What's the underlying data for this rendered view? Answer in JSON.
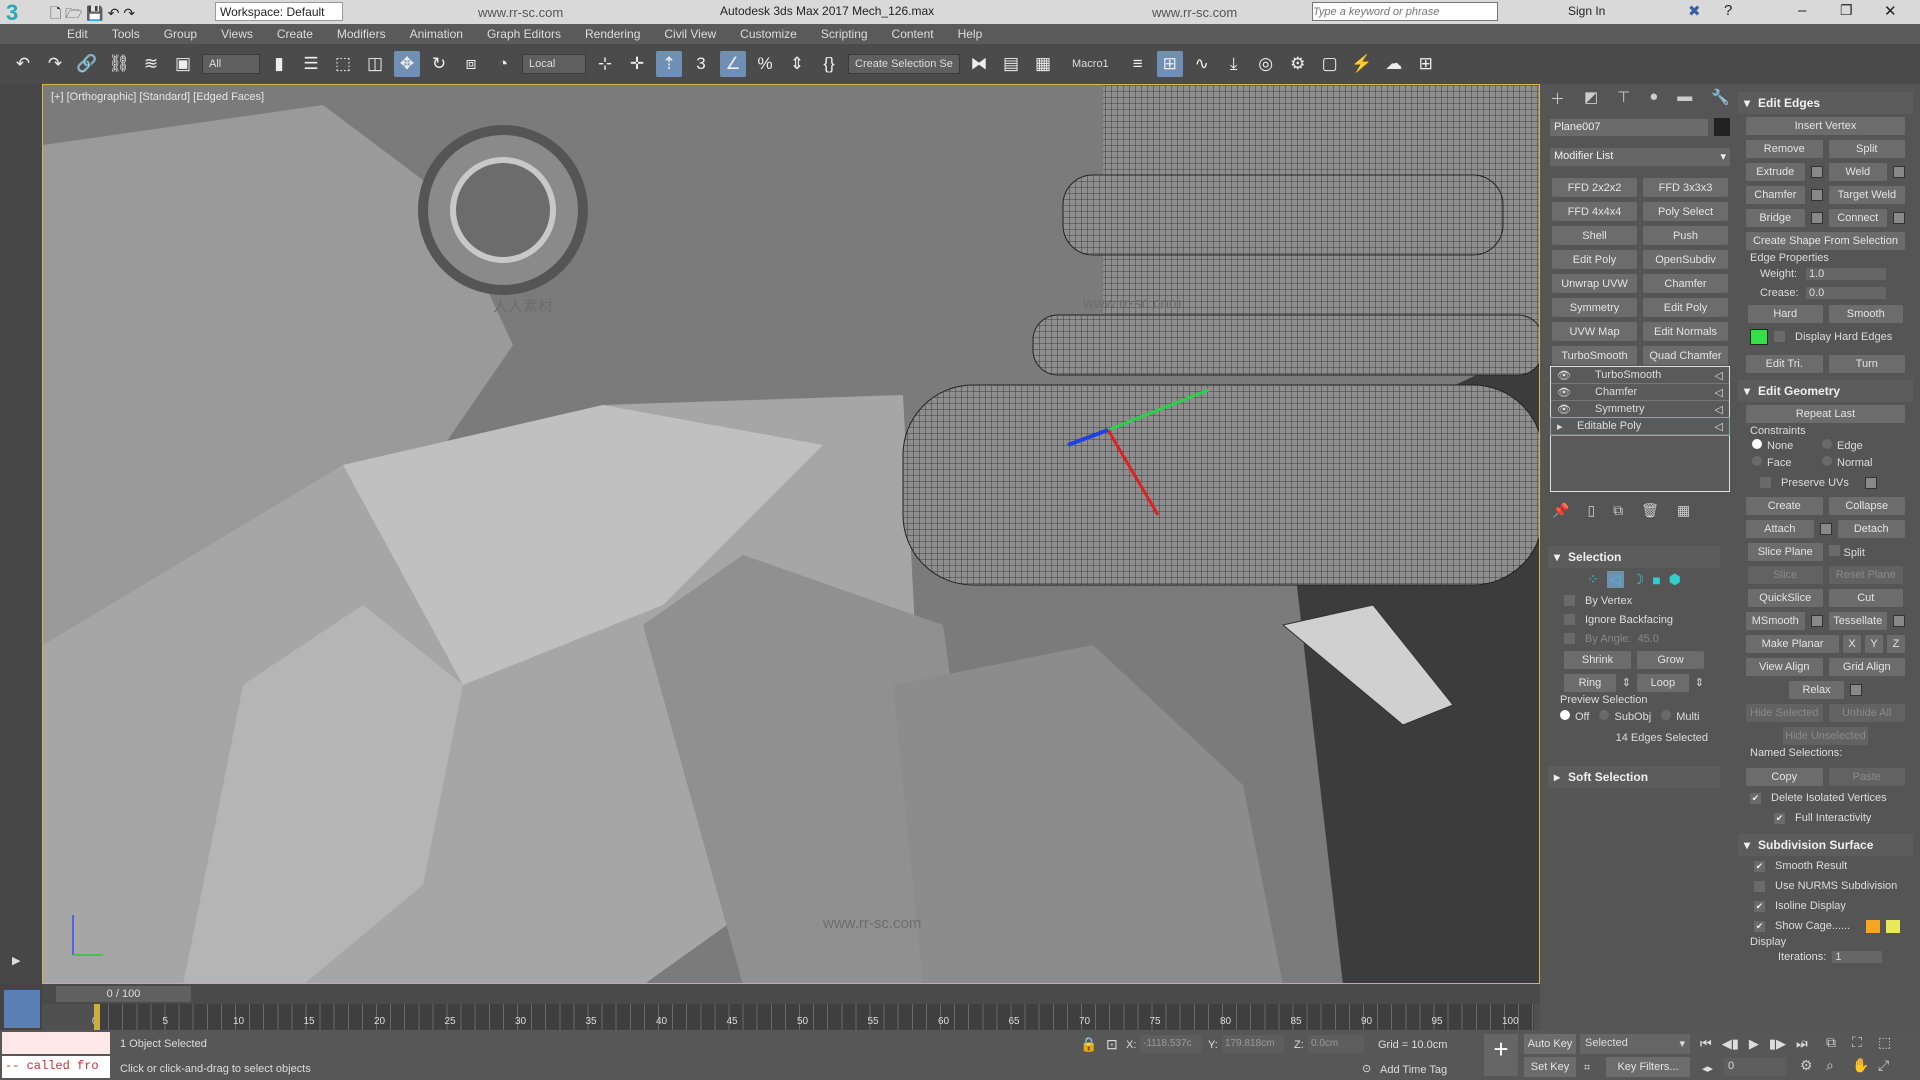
{
  "titlebar": {
    "workspace": "Workspace: Default",
    "title": "Autodesk 3ds Max 2017   Mech_126.max",
    "search_placeholder": "Type a keyword or phrase",
    "sign_in": "Sign In",
    "watermark": "www.rr-sc.com"
  },
  "menu": [
    "Edit",
    "Tools",
    "Group",
    "Views",
    "Create",
    "Modifiers",
    "Animation",
    "Graph Editors",
    "Rendering",
    "Civil View",
    "Customize",
    "Scripting",
    "Content",
    "Help"
  ],
  "toolbar": {
    "selection_filter": "All",
    "ref_coord": "Local",
    "named_selection": "Create Selection Se",
    "macro": "Macro1"
  },
  "viewport": {
    "label": "[+] [Orthographic] [Standard] [Edged Faces]",
    "watermark_cn": "人人素材",
    "watermark_url": "www.rr-sc.com"
  },
  "command_panel": {
    "object_name": "Plane007",
    "object_color": "#222222",
    "modifier_list": "Modifier List",
    "modifier_buttons": [
      "FFD 2x2x2",
      "FFD 3x3x3",
      "FFD 4x4x4",
      "Poly Select",
      "Shell",
      "Push",
      "Edit Poly",
      "OpenSubdiv",
      "Unwrap UVW",
      "Chamfer",
      "Symmetry",
      "Edit Poly",
      "UVW Map",
      "Edit Normals",
      "TurboSmooth",
      "Quad Chamfer"
    ],
    "stack": [
      {
        "label": "TurboSmooth",
        "eye": true
      },
      {
        "label": "Chamfer",
        "eye": true
      },
      {
        "label": "Symmetry",
        "eye": true
      },
      {
        "label": "Editable Poly",
        "eye": false,
        "selected": true
      }
    ],
    "selection": {
      "title": "Selection",
      "by_vertex": "By Vertex",
      "ignore_backfacing": "Ignore Backfacing",
      "by_angle": "By Angle:",
      "by_angle_value": "45.0",
      "shrink": "Shrink",
      "grow": "Grow",
      "ring": "Ring",
      "loop": "Loop",
      "preview": "Preview Selection",
      "off": "Off",
      "subobj": "SubObj",
      "multi": "Multi",
      "status": "14 Edges Selected",
      "active_level": "edge"
    },
    "soft_selection": "Soft Selection"
  },
  "edit_edges": {
    "title": "Edit Edges",
    "insert_vertex": "Insert Vertex",
    "remove": "Remove",
    "split": "Split",
    "extrude": "Extrude",
    "weld": "Weld",
    "chamfer": "Chamfer",
    "target_weld": "Target Weld",
    "bridge": "Bridge",
    "connect": "Connect",
    "create_shape": "Create Shape From Selection",
    "edge_properties": "Edge Properties",
    "weight_label": "Weight:",
    "weight": "1.0",
    "crease_label": "Crease:",
    "crease": "0.0",
    "hard": "Hard",
    "smooth": "Smooth",
    "display_hard_edges": "Display Hard Edges",
    "hard_edge_color": "#33e04a",
    "edit_tri": "Edit Tri.",
    "turn": "Turn"
  },
  "edit_geometry": {
    "title": "Edit Geometry",
    "repeat_last": "Repeat Last",
    "constraints": "Constraints",
    "none": "None",
    "edge": "Edge",
    "face": "Face",
    "normal": "Normal",
    "preserve_uvs": "Preserve UVs",
    "create": "Create",
    "collapse": "Collapse",
    "attach": "Attach",
    "detach": "Detach",
    "slice_plane": "Slice Plane",
    "split": "Split",
    "slice": "Slice",
    "reset_plane": "Reset Plane",
    "quickslice": "QuickSlice",
    "cut": "Cut",
    "msmooth": "MSmooth",
    "tessellate": "Tessellate",
    "make_planar": "Make Planar",
    "x": "X",
    "y": "Y",
    "z": "Z",
    "view_align": "View Align",
    "grid_align": "Grid Align",
    "relax": "Relax",
    "hide_selected": "Hide Selected",
    "unhide_all": "Unhide All",
    "hide_unselected": "Hide Unselected",
    "named_selections": "Named Selections:",
    "copy": "Copy",
    "paste": "Paste",
    "delete_isolated": "Delete Isolated Vertices",
    "full_interactivity": "Full Interactivity"
  },
  "subdivision": {
    "title": "Subdivision Surface",
    "smooth_result": "Smooth Result",
    "use_nurms": "Use NURMS Subdivision",
    "isoline": "Isoline Display",
    "show_cage": "Show Cage......",
    "cage_color1": "#f5a623",
    "cage_color2": "#e8e85a",
    "display": "Display",
    "iterations_label": "Iterations:",
    "iterations": "1"
  },
  "timeline": {
    "frame": "0 / 100",
    "ticks": [
      "0",
      "5",
      "10",
      "15",
      "20",
      "25",
      "30",
      "35",
      "40",
      "45",
      "50",
      "55",
      "60",
      "65",
      "70",
      "75",
      "80",
      "85",
      "90",
      "95",
      "100"
    ]
  },
  "status": {
    "listener": "-- called fro",
    "selected": "1 Object Selected",
    "prompt": "Click or click-and-drag to select objects",
    "x_label": "X:",
    "x": "-1118.537c",
    "y_label": "Y:",
    "y": "179.818cm",
    "z_label": "Z:",
    "z": "0.0cm",
    "grid": "Grid = 10.0cm",
    "add_time_tag": "Add Time Tag",
    "auto_key": "Auto Key",
    "set_key": "Set Key",
    "key_mode": "Selected",
    "key_filters": "Key Filters...",
    "current_frame": "0"
  }
}
